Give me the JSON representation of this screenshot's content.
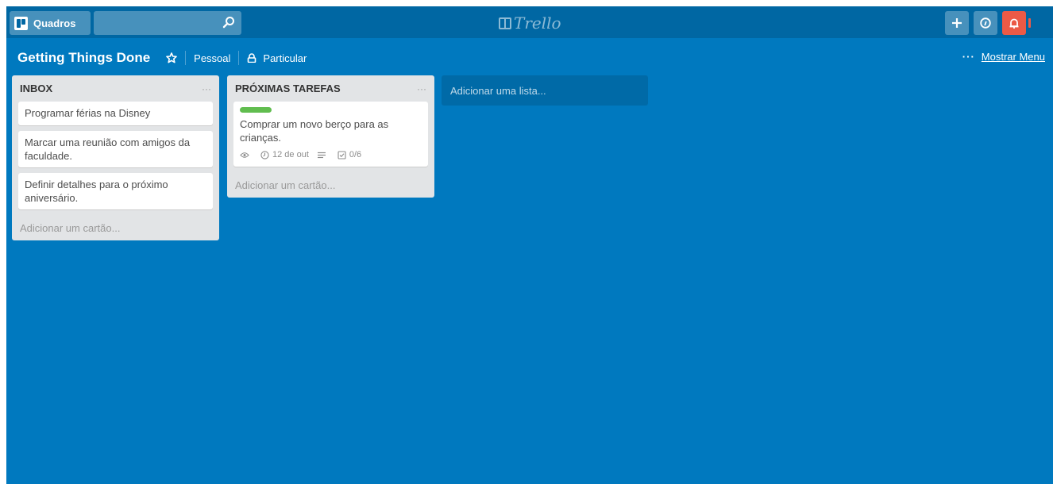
{
  "header": {
    "boards_label": "Quadros",
    "search_placeholder": "",
    "logo_text": "Trello"
  },
  "board": {
    "title": "Getting Things Done",
    "team": "Pessoal",
    "visibility": "Particular",
    "menu_label": "Mostrar Menu"
  },
  "lists": [
    {
      "title": "INBOX",
      "menu": "···",
      "cards": [
        {
          "text": "Programar férias na Disney"
        },
        {
          "text": "Marcar uma reunião com amigos da faculdade."
        },
        {
          "text": "Definir detalhes para o próximo aniversário."
        }
      ],
      "add_card": "Adicionar um cartão..."
    },
    {
      "title": "PRÓXIMAS TAREFAS",
      "menu": "···",
      "cards": [
        {
          "text": "Comprar um novo berço para as crianças.",
          "label_color": "#61bd4f",
          "due": "12 de out",
          "checklist": "0/6"
        }
      ],
      "add_card": "Adicionar um cartão..."
    }
  ],
  "add_list": "Adicionar uma lista...",
  "colors": {
    "board_bg": "#0079bf",
    "header_bg": "#0067a3",
    "list_bg": "#e2e4e6",
    "notification": "#eb5a46",
    "label_green": "#61bd4f"
  }
}
